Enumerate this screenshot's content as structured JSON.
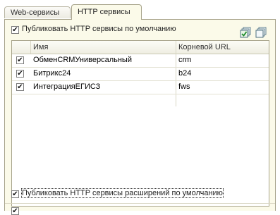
{
  "tabs": [
    {
      "label": "Web-сервисы",
      "active": false
    },
    {
      "label": "HTTP сервисы",
      "active": true
    }
  ],
  "publish_default": {
    "label": "Публиковать HTTP сервисы по умолчанию",
    "checked": true
  },
  "toolbar": {
    "check_all_icon": "check-all-icon",
    "uncheck_all_icon": "uncheck-all-icon"
  },
  "table": {
    "columns": [
      "Имя",
      "Корневой URL"
    ],
    "rows": [
      {
        "checked": true,
        "name": "ОбменCRMУниверсальный",
        "url": "crm"
      },
      {
        "checked": true,
        "name": "Битрикс24",
        "url": "b24"
      },
      {
        "checked": true,
        "name": "ИнтеграцияЕГИСЗ",
        "url": "fws"
      }
    ]
  },
  "publish_extensions": {
    "label": "Публиковать HTTP сервисы расширений по умолчанию",
    "checked": true
  }
}
